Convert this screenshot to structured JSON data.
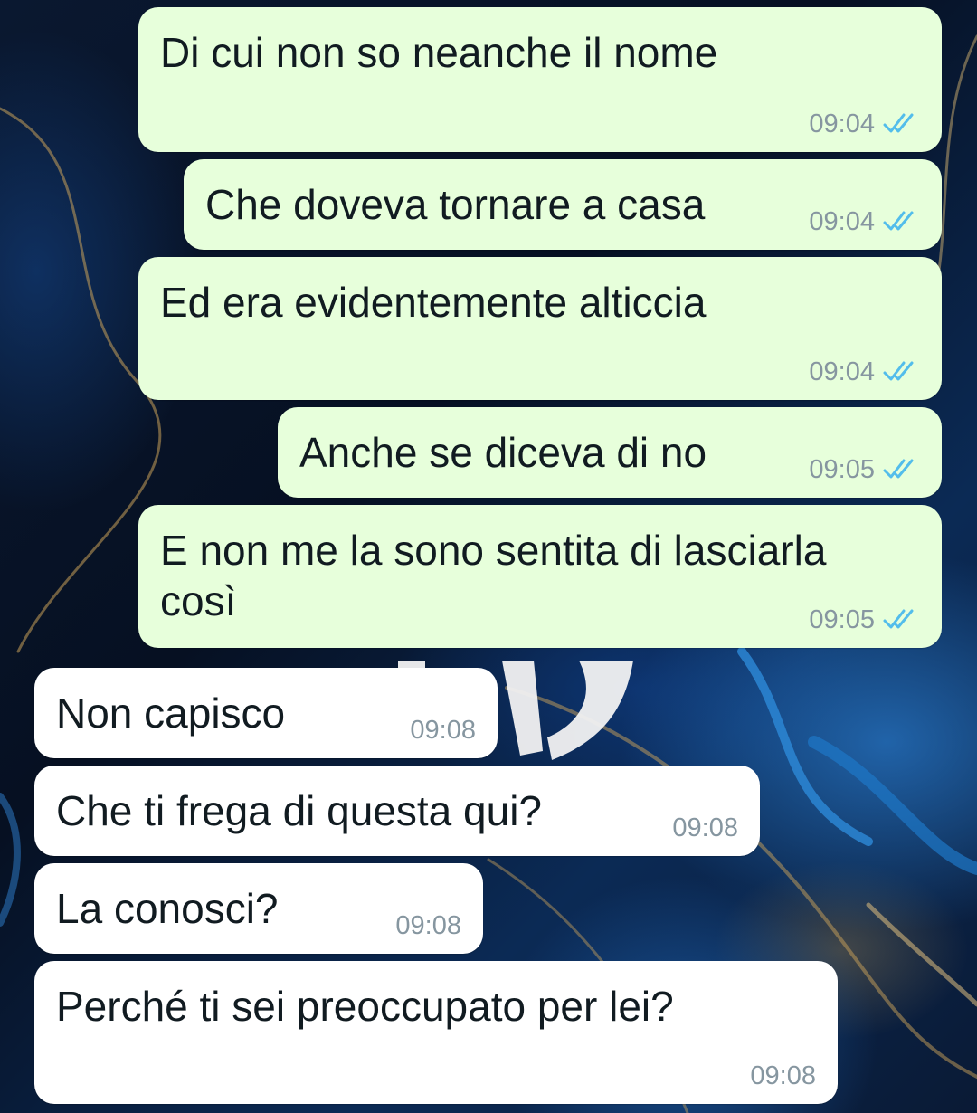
{
  "chat": {
    "messages": [
      {
        "direction": "outgoing",
        "text": "Di cui non so neanche il nome",
        "time": "09:04",
        "status": "read"
      },
      {
        "direction": "outgoing",
        "text": "Che doveva tornare a casa",
        "time": "09:04",
        "status": "read"
      },
      {
        "direction": "outgoing",
        "text": "Ed era evidentemente alticcia",
        "time": "09:04",
        "status": "read"
      },
      {
        "direction": "outgoing",
        "text": "Anche se diceva di no",
        "time": "09:05",
        "status": "read"
      },
      {
        "direction": "outgoing",
        "text": "E non me la sono sentita di lasciarla\ncosì",
        "time": "09:05",
        "status": "read"
      },
      {
        "direction": "incoming",
        "text": "Non capisco",
        "time": "09:08"
      },
      {
        "direction": "incoming",
        "text": "Che ti frega di questa qui?",
        "time": "09:08"
      },
      {
        "direction": "incoming",
        "text": "La conosci?",
        "time": "09:08"
      },
      {
        "direction": "incoming",
        "text": "Perché ti sei preoccupato per lei?",
        "time": "09:08"
      }
    ]
  },
  "colors": {
    "outgoing_bubble": "#e7ffdb",
    "incoming_bubble": "#ffffff",
    "read_ticks": "#53bdeb",
    "timestamp": "#8696a0",
    "message_text": "#111b21"
  },
  "icons": {
    "read_receipt": "double-check-icon"
  }
}
